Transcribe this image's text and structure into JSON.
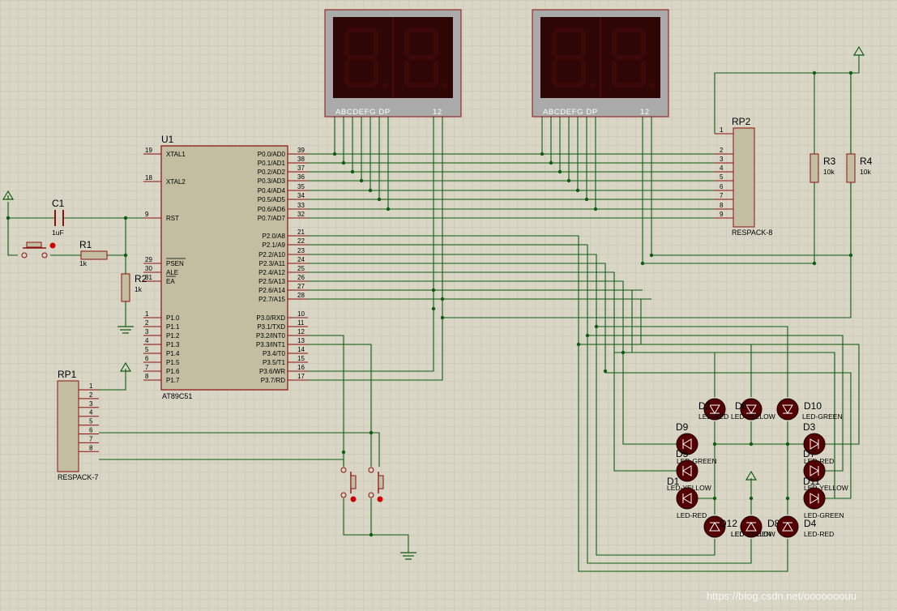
{
  "colors": {
    "background": "#d9d6c6",
    "grid": "#c4c0ae",
    "wire": "#0e5c12",
    "body": "#c3bea2",
    "outline": "#8b1010",
    "display_bg": "#aaaaaa",
    "display_face": "#2e0606",
    "segment_off": "#3c0808",
    "led_body": "#550000",
    "junction": "#0e5c12"
  },
  "u1": {
    "ref": "U1",
    "part": "AT89C51",
    "left_pins": [
      {
        "num": "19",
        "name": "XTAL1"
      },
      {
        "num": "18",
        "name": "XTAL2"
      },
      {
        "num": "9",
        "name": "RST"
      },
      {
        "num": "29",
        "name": "PSEN"
      },
      {
        "num": "30",
        "name": "ALE"
      },
      {
        "num": "31",
        "name": "EA"
      },
      {
        "num": "1",
        "name": "P1.0"
      },
      {
        "num": "2",
        "name": "P1.1"
      },
      {
        "num": "3",
        "name": "P1.2"
      },
      {
        "num": "4",
        "name": "P1.3"
      },
      {
        "num": "5",
        "name": "P1.4"
      },
      {
        "num": "6",
        "name": "P1.5"
      },
      {
        "num": "7",
        "name": "P1.6"
      },
      {
        "num": "8",
        "name": "P1.7"
      }
    ],
    "right_pins": [
      {
        "num": "39",
        "name": "P0.0/AD0"
      },
      {
        "num": "38",
        "name": "P0.1/AD1"
      },
      {
        "num": "37",
        "name": "P0.2/AD2"
      },
      {
        "num": "36",
        "name": "P0.3/AD3"
      },
      {
        "num": "35",
        "name": "P0.4/AD4"
      },
      {
        "num": "34",
        "name": "P0.5/AD5"
      },
      {
        "num": "33",
        "name": "P0.6/AD6"
      },
      {
        "num": "32",
        "name": "P0.7/AD7"
      },
      {
        "num": "21",
        "name": "P2.0/A8"
      },
      {
        "num": "22",
        "name": "P2.1/A9"
      },
      {
        "num": "23",
        "name": "P2.2/A10"
      },
      {
        "num": "24",
        "name": "P2.3/A11"
      },
      {
        "num": "25",
        "name": "P2.4/A12"
      },
      {
        "num": "26",
        "name": "P2.5/A13"
      },
      {
        "num": "27",
        "name": "P2.6/A14"
      },
      {
        "num": "28",
        "name": "P2.7/A15"
      },
      {
        "num": "10",
        "name": "P3.0/RXD"
      },
      {
        "num": "11",
        "name": "P3.1/TXD"
      },
      {
        "num": "12",
        "name": "P3.2/INT0"
      },
      {
        "num": "13",
        "name": "P3.3/INT1"
      },
      {
        "num": "14",
        "name": "P3.4/T0"
      },
      {
        "num": "15",
        "name": "P3.5/T1"
      },
      {
        "num": "16",
        "name": "P3.6/WR"
      },
      {
        "num": "17",
        "name": "P3.7/RD"
      }
    ]
  },
  "c1": {
    "ref": "C1",
    "value": "1uF"
  },
  "r1": {
    "ref": "R1",
    "value": "1k"
  },
  "r2": {
    "ref": "R2",
    "value": "1k"
  },
  "r3": {
    "ref": "R3",
    "value": "10k"
  },
  "r4": {
    "ref": "R4",
    "value": "10k"
  },
  "rp1": {
    "ref": "RP1",
    "part": "RESPACK-7",
    "pins": [
      "1",
      "2",
      "3",
      "4",
      "5",
      "6",
      "7",
      "8"
    ]
  },
  "rp2": {
    "ref": "RP2",
    "part": "RESPACK-8",
    "pins": [
      "1",
      "2",
      "3",
      "4",
      "5",
      "6",
      "7",
      "8",
      "9"
    ]
  },
  "displays": [
    {
      "segments_label": "ABCDEFG  DP",
      "digits_label": "12"
    },
    {
      "segments_label": "ABCDEFG  DP",
      "digits_label": "12"
    }
  ],
  "leds": [
    {
      "ref": "D2",
      "part": "LED-RED"
    },
    {
      "ref": "D6",
      "part": "LED-YELLOW"
    },
    {
      "ref": "D10",
      "part": "LED-GREEN"
    },
    {
      "ref": "D9",
      "part": "LED-GREEN"
    },
    {
      "ref": "D3",
      "part": "LED-RED"
    },
    {
      "ref": "D5",
      "part": "LED-YELLOW"
    },
    {
      "ref": "D7",
      "part": "LED-YELLOW"
    },
    {
      "ref": "D1",
      "part": "LED-RED"
    },
    {
      "ref": "D11",
      "part": "LED-GREEN"
    },
    {
      "ref": "D12",
      "part": "LED-GREEN"
    },
    {
      "ref": "D8",
      "part": "LED-YELLOW"
    },
    {
      "ref": "D4",
      "part": "LED-RED"
    }
  ],
  "watermark": "https://blog.csdn.net/ooooooouu"
}
